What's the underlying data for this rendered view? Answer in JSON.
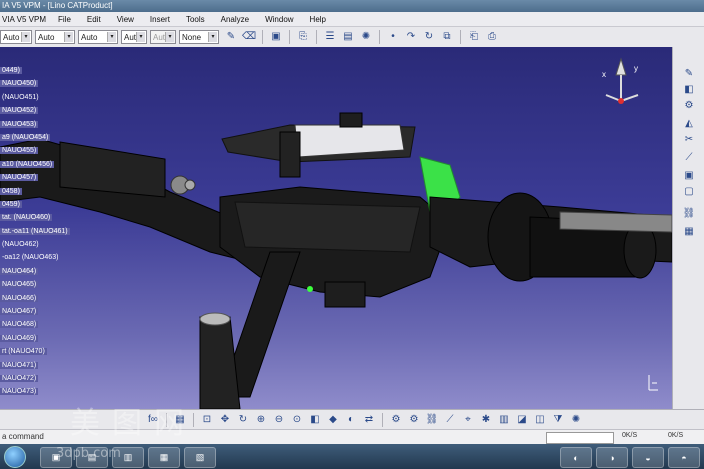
{
  "window": {
    "title": "IA V5 VPM - [Lino CATProduct]"
  },
  "menu": {
    "app_label": "VIA V5 VPM",
    "items": [
      "File",
      "Edit",
      "View",
      "Insert",
      "Tools",
      "Analyze",
      "Window",
      "Help"
    ]
  },
  "toolbar": {
    "combos": [
      {
        "value": "Auto",
        "disabled": false
      },
      {
        "value": "Auto",
        "disabled": false
      },
      {
        "value": "Auto",
        "disabled": false
      },
      {
        "value": "Aut",
        "disabled": false
      },
      {
        "value": "Aut",
        "disabled": true
      },
      {
        "value": "None",
        "disabled": false
      }
    ]
  },
  "tree": {
    "items": [
      {
        "label": "0449)",
        "highlight": true
      },
      {
        "label": "NAUO450)",
        "highlight": true
      },
      {
        "label": "(NAUO451)",
        "highlight": false
      },
      {
        "label": "NAUO452)",
        "highlight": true
      },
      {
        "label": "NAUO453)",
        "highlight": true
      },
      {
        "label": "a9 (NAUO454)",
        "highlight": true
      },
      {
        "label": "NAUO455)",
        "highlight": true
      },
      {
        "label": "a10 (NAUO456)",
        "highlight": true
      },
      {
        "label": "NAUO457)",
        "highlight": true
      },
      {
        "label": "0458)",
        "highlight": true
      },
      {
        "label": "0459)",
        "highlight": true
      },
      {
        "label": "tat. (NAUO460)",
        "highlight": true
      },
      {
        "label": "tat.-oa11 (NAUO461)",
        "highlight": true
      },
      {
        "label": "(NAUO462)",
        "highlight": false
      },
      {
        "label": "-oa12 (NAUO463)",
        "highlight": false
      },
      {
        "label": "NAUO464)",
        "highlight": true
      },
      {
        "label": "NAUO465)",
        "highlight": true
      },
      {
        "label": "NAUO466)",
        "highlight": true
      },
      {
        "label": "NAUO467)",
        "highlight": true
      },
      {
        "label": "NAUO468)",
        "highlight": true
      },
      {
        "label": "NAUO469)",
        "highlight": true
      },
      {
        "label": "rt   (NAUO470)",
        "highlight": true
      },
      {
        "label": "NAUO471)",
        "highlight": true
      },
      {
        "label": "NAUO472)",
        "highlight": true
      },
      {
        "label": "NAUO473)",
        "highlight": true
      }
    ]
  },
  "compass": {
    "x_label": "x",
    "y_label": "y"
  },
  "status": {
    "prompt": "a command",
    "speed1": "0K/S",
    "speed2": "0K/S"
  },
  "watermark": {
    "text": "美图网",
    "url": "3dpb.com"
  },
  "colors": {
    "viewport_top": "#2a2a78",
    "viewport_bottom": "#8f8ccb",
    "tree_highlight": "#5b5ba0",
    "selection_green": "#3cff3c"
  }
}
